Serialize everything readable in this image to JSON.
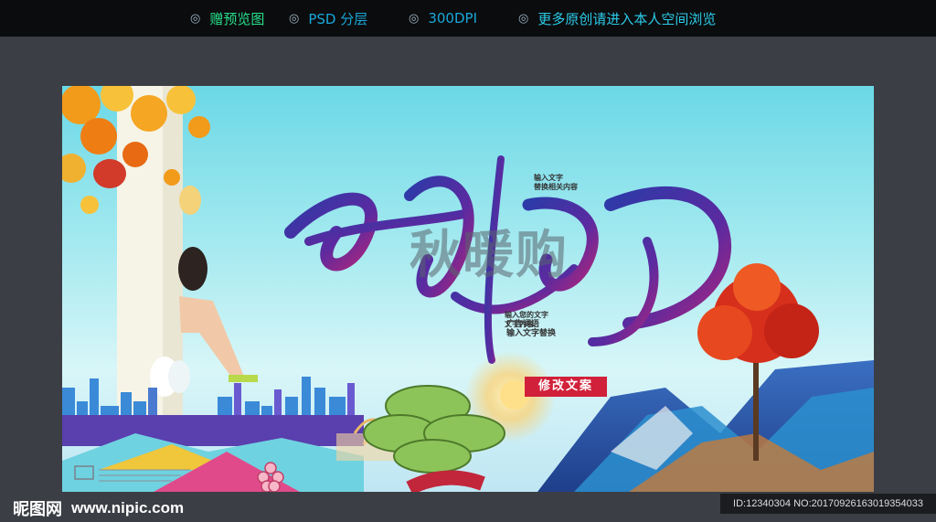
{
  "topbar": {
    "items": [
      {
        "bullet": "◎",
        "label": "赠预览图"
      },
      {
        "bullet": "◎",
        "label": "PSD 分层"
      },
      {
        "bullet": "◎",
        "label": "300DPI"
      },
      {
        "bullet": "◎",
        "label": "更多原创请进入本人空间浏览"
      }
    ]
  },
  "poster": {
    "title": "秋暖购",
    "badge": "修改文案",
    "note_top_1": "输入文字",
    "note_top_2": "替换相关内容",
    "note_badge_1": "输入您的文字",
    "note_badge_2": "文字内容",
    "note_bottom_1": "广告词语",
    "note_bottom_2": "输入文字替换"
  },
  "footer": {
    "logo": "昵图网",
    "url": "www.nipic.com",
    "id_text": "ID:12340304 NO:20170926163019354033"
  },
  "colors": {
    "topbar_bg": "#0b0c0e",
    "bullet": "#9fb7c4",
    "link_green": "#27e08b",
    "link_blue": "#19a7d8",
    "calligraphy_purple": "#5b2aa0",
    "badge_red": "#d1203a",
    "page_bg": "#3b3e44"
  }
}
